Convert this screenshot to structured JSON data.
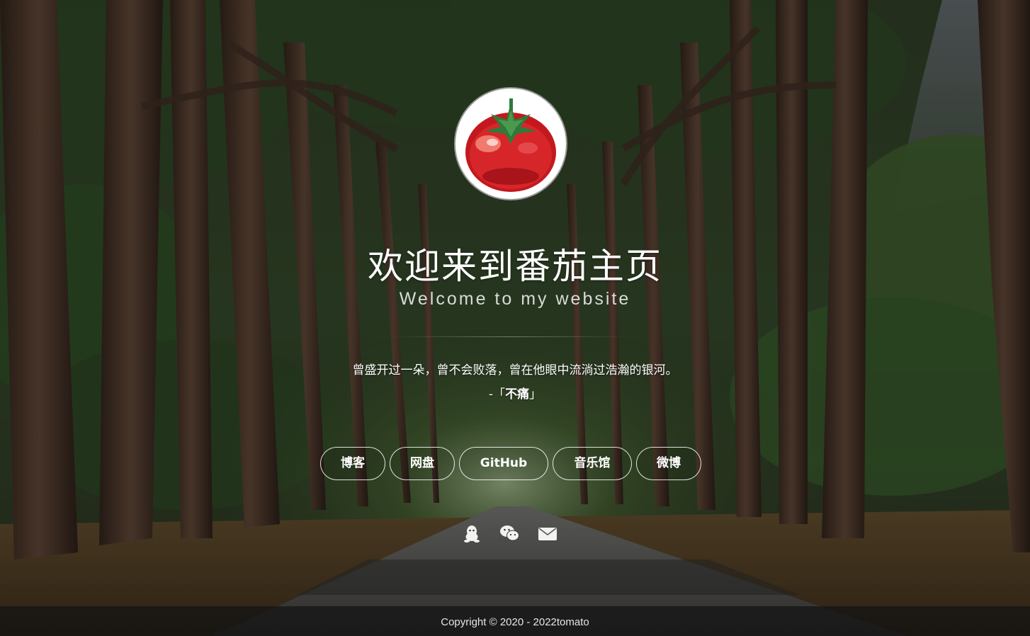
{
  "header": {
    "title": "欢迎来到番茄主页",
    "subtitle": "Welcome to my website"
  },
  "quote": {
    "text": "曾盛开过一朵，曾不会败落，曾在他眼中流淌过浩瀚的银河。",
    "author_prefix": "-「",
    "author": "不痛",
    "author_suffix": "」"
  },
  "nav": {
    "items": [
      {
        "label": "博客"
      },
      {
        "label": "网盘"
      },
      {
        "label": "GitHub"
      },
      {
        "label": "音乐馆"
      },
      {
        "label": "微博"
      }
    ]
  },
  "social": {
    "icons": [
      "qq-icon",
      "wechat-icon",
      "mail-icon"
    ]
  },
  "footer": {
    "copyright": "Copyright © 2020 - 2022tomato"
  },
  "colors": {
    "accent": "#ffffff",
    "tomato": "#d7262a",
    "leaf": "#2f7a3a"
  }
}
